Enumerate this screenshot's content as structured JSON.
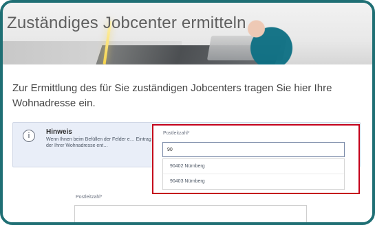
{
  "hero": {
    "title": "Zuständiges Jobcenter ermitteln"
  },
  "main": {
    "lead_text": "Zur Ermittlung des für Sie zuständigen Jobcenters tragen Sie hier Ihre Wohnadresse ein."
  },
  "hint": {
    "icon": "info-icon",
    "title": "Hinweis",
    "text": "Wenn Ihnen beim Befüllen der Felder e… Eintrag aus, der Ihrer Wohnadresse ent…"
  },
  "postcode_popup": {
    "label": "Postleitzahl*",
    "value": "90",
    "options": [
      "90402 Nürnberg",
      "90403 Nürnberg"
    ]
  },
  "postcode_field": {
    "label": "Postleitzahl*",
    "value": ""
  },
  "colors": {
    "frame": "#1f6f74",
    "highlight": "#c4001a",
    "hint_bg": "#e9eef8"
  }
}
